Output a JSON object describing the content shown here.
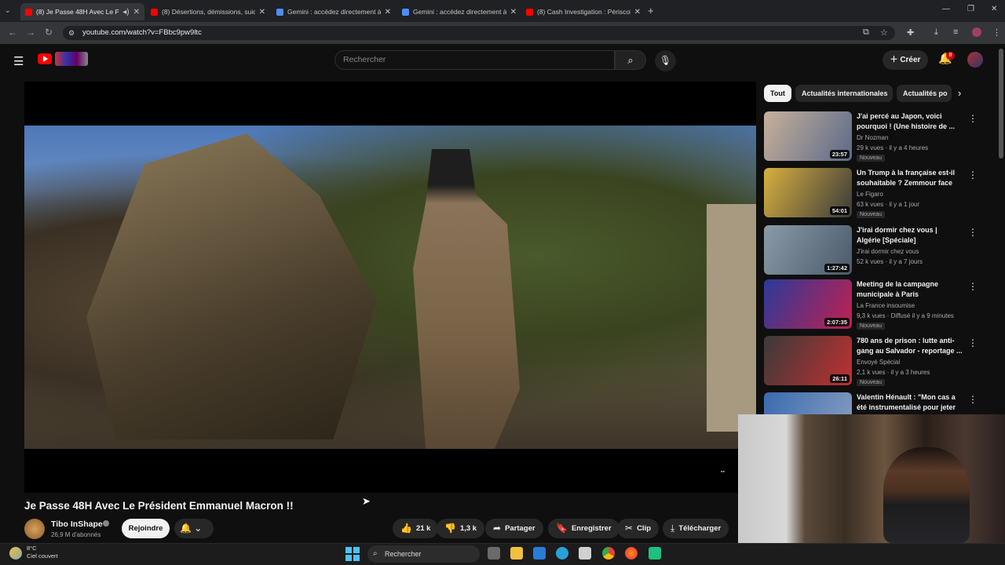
{
  "browser": {
    "tabs": [
      {
        "label": "(8) Je Passe 48H Avec Le Pr",
        "active": true,
        "favicon_color": "#ff0000"
      },
      {
        "label": "(8) Désertions, démissions, suic",
        "active": false,
        "favicon_color": "#ff0000"
      },
      {
        "label": "Gemini : accédez directement à",
        "active": false,
        "favicon_color": "#4f8ef7"
      },
      {
        "label": "Gemini : accédez directement à",
        "active": false,
        "favicon_color": "#4f8ef7"
      },
      {
        "label": "(8) Cash Investigation : Périscol",
        "active": false,
        "favicon_color": "#ff0000"
      }
    ],
    "url": "youtube.com/watch?v=FBbc9pw9ltc"
  },
  "youtube": {
    "search_placeholder": "Rechercher",
    "create_label": "Créer",
    "notification_count": "8"
  },
  "video": {
    "title": "Je Passe 48H Avec Le Président Emmanuel Macron !!",
    "channel_name": "Tibo InShape",
    "subscribers": "26,9 M d'abonnés",
    "join_label": "Rejoindre",
    "likes": "21 k",
    "dislikes": "1,3 k",
    "share_label": "Partager",
    "save_label": "Enregistrer",
    "clip_label": "Clip",
    "download_label": "Télécharger"
  },
  "chips": [
    "Tout",
    "Actualités internationales",
    "Actualités po"
  ],
  "recommendations": [
    {
      "title": "J'ai percé au Japon, voici pourquoi ! (Une histoire de ...",
      "channel": "Dr Nozman",
      "meta": "29 k vues · il y a 4 heures",
      "badge": "Nouveau",
      "duration": "23:57",
      "thumb_colors": [
        "#c8b09a",
        "#5a6a8a"
      ]
    },
    {
      "title": "Un Trump à la française est-il souhaitable ? Zemmour face à...",
      "channel": "Le Figaro",
      "meta": "63 k vues · il y a 1 jour",
      "badge": "Nouveau",
      "duration": "54:01",
      "thumb_colors": [
        "#d8b040",
        "#3a3a3a"
      ]
    },
    {
      "title": "J'irai dormir chez vous | Algérie [Spéciale]",
      "channel": "J'irai dormir chez vous",
      "meta": "52 k vues · il y a 7 jours",
      "badge": "",
      "duration": "1:27:42",
      "thumb_colors": [
        "#8a9aa8",
        "#4a5a6a"
      ]
    },
    {
      "title": "Meeting de la campagne municipale à Paris",
      "channel": "La France insoumise",
      "meta": "9,3 k vues · Diffusé il y a 9 minutes",
      "badge": "Nouveau",
      "duration": "2:07:35",
      "thumb_colors": [
        "#2a3a9a",
        "#c02050"
      ]
    },
    {
      "title": "780 ans de prison : lutte anti-gang au Salvador - reportage ...",
      "channel": "Envoyé Spécial",
      "meta": "2,1 k vues · il y a 3 heures",
      "badge": "Nouveau",
      "duration": "26:11",
      "thumb_colors": [
        "#3a3a3a",
        "#c03030"
      ]
    },
    {
      "title": "Valentin Hénault : \"Mon cas a été instrumentalisé pour jeter l...",
      "channel": "",
      "meta": "",
      "badge": "",
      "duration": "",
      "thumb_colors": [
        "#3a6ab0",
        "#8aa0c0"
      ]
    }
  ],
  "taskbar": {
    "temperature": "8°C",
    "weather": "Ciel couvert",
    "search_label": "Rechercher"
  },
  "icons": {
    "menu": "hamburger-icon",
    "search": "search-icon",
    "mic": "mic-icon",
    "bell": "bell-icon",
    "like": "thumbs-up-icon",
    "dislike": "thumbs-down-icon",
    "share": "share-icon",
    "save": "bookmark-icon",
    "clip": "scissors-icon",
    "download": "download-icon"
  }
}
